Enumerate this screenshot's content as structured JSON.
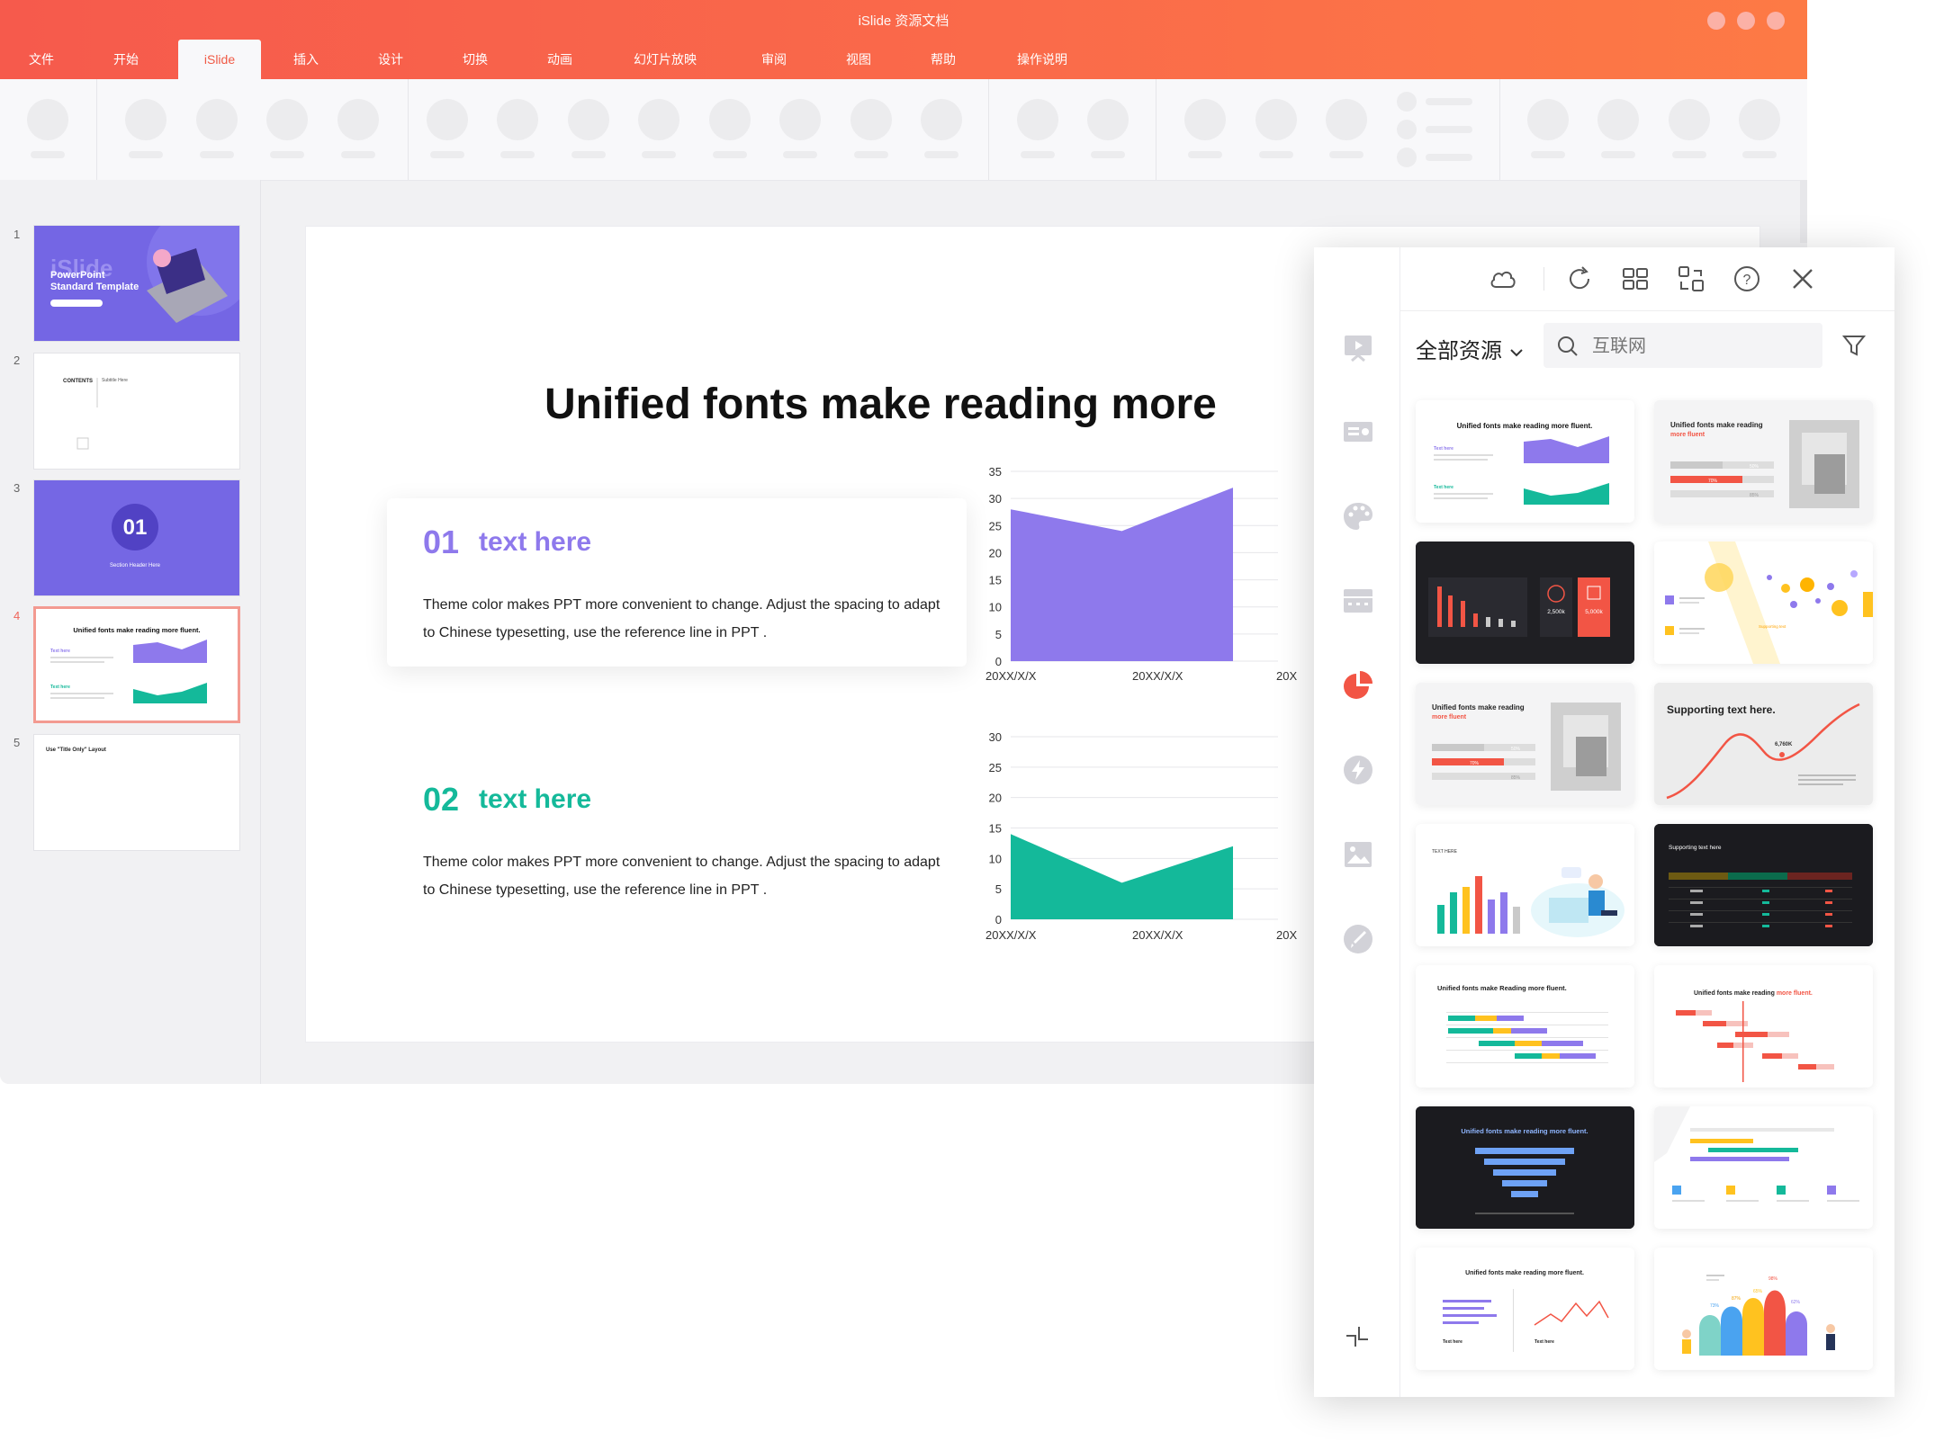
{
  "window": {
    "title": "iSlide 资源文档"
  },
  "menu": {
    "tabs": [
      "文件",
      "开始",
      "iSlide",
      "插入",
      "设计",
      "切换",
      "动画",
      "幻灯片放映",
      "审阅",
      "视图",
      "帮助",
      "操作说明"
    ],
    "active_tab": "iSlide"
  },
  "thumbnails": [
    {
      "num": "1",
      "hero": "iSlide",
      "line1": "PowerPoint",
      "line2": "Standard Template"
    },
    {
      "num": "2",
      "contents": "CONTENTS",
      "subtitle": "Subtitle Here"
    },
    {
      "num": "3",
      "number": "01",
      "label": "Section Header Here"
    },
    {
      "num": "4",
      "title": "Unified fonts make reading more fluent.",
      "t1": "Text here",
      "t2": "Text here"
    },
    {
      "num": "5",
      "label": "Use \"Title Only\" Layout"
    }
  ],
  "slide": {
    "title": "Unified fonts make reading more",
    "item1": {
      "num": "01",
      "sub": "text here",
      "body": "Theme color makes PPT more convenient to change. Adjust the spacing to adapt to Chinese typesetting, use the reference line in PPT ."
    },
    "item2": {
      "num": "02",
      "sub": "text here",
      "body": "Theme color makes PPT more convenient to change. Adjust the spacing to adapt to Chinese typesetting, use the reference line in PPT ."
    },
    "colors": {
      "purple": "#8e79ec",
      "green": "#14b99a"
    }
  },
  "chart_data": [
    {
      "type": "area",
      "categories": [
        "20XX/X/X",
        "20XX/X/X",
        "20X"
      ],
      "values": [
        28,
        24,
        32
      ],
      "yticks": [
        "35",
        "30",
        "25",
        "20",
        "15",
        "10",
        "5",
        "0"
      ],
      "ylim": [
        0,
        35
      ],
      "grid": true,
      "color": "#8e79ec"
    },
    {
      "type": "area",
      "categories": [
        "20XX/X/X",
        "20XX/X/X",
        "20X"
      ],
      "values": [
        14,
        6,
        12
      ],
      "yticks": [
        "30",
        "25",
        "20",
        "15",
        "10",
        "5",
        "0"
      ],
      "ylim": [
        0,
        30
      ],
      "grid": true,
      "color": "#14b99a"
    }
  ],
  "panel": {
    "resource_label": "全部资源",
    "search_placeholder": "互联网",
    "toolbar_icons": [
      "cloud-icon",
      "refresh-icon",
      "grid-icon",
      "swap-icon",
      "help-icon",
      "close-icon"
    ],
    "rail_icons": [
      "slideshow-icon",
      "layout-icon",
      "palette-icon",
      "table-icon",
      "pie-chart-icon",
      "lightning-icon",
      "image-icon",
      "brush-icon"
    ],
    "cards": [
      {
        "title": "Unified fonts make reading more fluent.",
        "sub1": "Text here",
        "sub2": "Text here"
      },
      {
        "title": "Unified fonts make reading",
        "accent": "more fluent",
        "p1": "50%",
        "p2": "70%",
        "p3": "85%"
      },
      {
        "v1": "2,500k",
        "v2": "5,000k"
      },
      {
        "title": "Supporting text"
      },
      {
        "title": "Unified fonts make reading",
        "accent": "more fluent",
        "p1": "50%",
        "p2": "70%",
        "p3": "85%"
      },
      {
        "title": "Supporting text here.",
        "value": "6,760K"
      },
      {
        "title": "TEXT HERE"
      },
      {
        "title": "Supporting text here"
      },
      {
        "title": "Unified fonts make Reading more fluent."
      },
      {
        "title": "Unified fonts make reading",
        "accent": "more fluent."
      },
      {
        "title": "Unified fonts make reading more fluent."
      },
      {},
      {
        "title": "Unified fonts make reading more fluent.",
        "sub1": "Text here",
        "sub2": "Text here"
      },
      {
        "p1": "73%",
        "p2": "87%",
        "p3": "98%",
        "p4": "65%",
        "p5": "62%"
      }
    ]
  }
}
